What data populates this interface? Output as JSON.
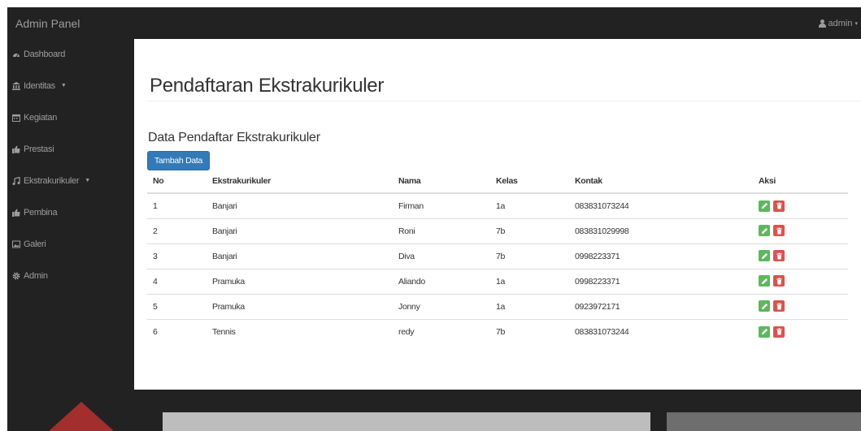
{
  "navbar": {
    "brand": "Admin Panel",
    "user": "admin"
  },
  "sidebar": {
    "items": [
      {
        "label": "Dashboard",
        "icon": "dashboard-icon"
      },
      {
        "label": "Identitas",
        "icon": "institution-icon",
        "dropdown": true
      },
      {
        "label": "Kegiatan",
        "icon": "calendar-icon"
      },
      {
        "label": "Prestasi",
        "icon": "thumbs-up-icon"
      },
      {
        "label": "Ekstrakurikuler",
        "icon": "music-icon",
        "dropdown": true
      },
      {
        "label": "Pembina",
        "icon": "thumbs-up-icon"
      },
      {
        "label": "Galeri",
        "icon": "picture-icon"
      },
      {
        "label": "Admin",
        "icon": "gear-icon"
      }
    ]
  },
  "main": {
    "title": "Pendaftaran Ekstrakurikuler",
    "subtitle": "Data Pendaftar Ekstrakurikuler",
    "add_button": "Tambah Data",
    "table": {
      "headers": [
        "No",
        "Ekstrakurikuler",
        "Nama",
        "Kelas",
        "Kontak",
        "Aksi"
      ],
      "rows": [
        [
          "1",
          "Banjari",
          "Firman",
          "1a",
          "083831073244"
        ],
        [
          "2",
          "Banjari",
          "Roni",
          "7b",
          "083831029998"
        ],
        [
          "3",
          "Banjari",
          "Diva",
          "7b",
          "0998223371"
        ],
        [
          "4",
          "Pramuka",
          "Aliando",
          "1a",
          "0998223371"
        ],
        [
          "5",
          "Pramuka",
          "Jonny",
          "1a",
          "0923972171"
        ],
        [
          "6",
          "Tennis",
          "redy",
          "7b",
          "083831073244"
        ]
      ]
    }
  },
  "colors": {
    "navbar": "#222222",
    "primary": "#337ab7",
    "success": "#5cb85c",
    "danger": "#d9534f"
  }
}
